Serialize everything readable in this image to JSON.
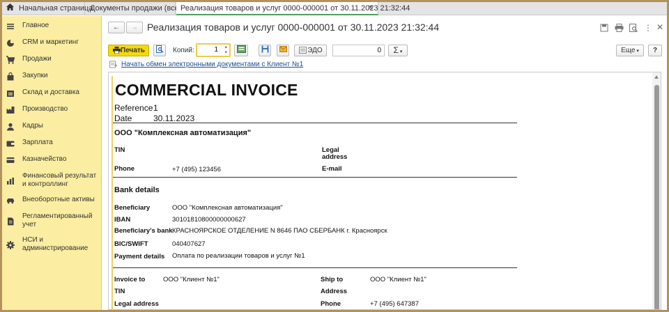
{
  "tabs": [
    {
      "label": "Начальная страница"
    },
    {
      "label": "Документы продажи (все)"
    },
    {
      "label": "Реализация товаров и услуг 0000-000001 от 30.11.2023 21:32:44"
    }
  ],
  "sidebar": {
    "items": [
      {
        "label": "Главное",
        "icon": "menu-icon"
      },
      {
        "label": "CRM и маркетинг",
        "icon": "pie-chart-icon"
      },
      {
        "label": "Продажи",
        "icon": "shopping-cart-icon"
      },
      {
        "label": "Закупки",
        "icon": "shopping-bag-icon"
      },
      {
        "label": "Склад и доставка",
        "icon": "warehouse-icon"
      },
      {
        "label": "Производство",
        "icon": "factory-icon"
      },
      {
        "label": "Кадры",
        "icon": "person-icon"
      },
      {
        "label": "Зарплата",
        "icon": "wallet-icon"
      },
      {
        "label": "Казначейство",
        "icon": "bank-card-icon"
      },
      {
        "label": "Финансовый результат и контроллинг",
        "icon": "bar-chart-icon"
      },
      {
        "label": "Внеоборотные активы",
        "icon": "car-icon"
      },
      {
        "label": "Регламентированный учет",
        "icon": "document-icon"
      },
      {
        "label": "НСИ и администрирование",
        "icon": "gear-icon"
      }
    ]
  },
  "header": {
    "title": "Реализация товаров и услуг 0000-000001 от 30.11.2023 21:32:44"
  },
  "toolbar": {
    "print_label": "Печать",
    "copies_label": "Копий:",
    "copies_value": "1",
    "edo_label": "ЭДО",
    "sum_value": "0",
    "sigma_label": "Σ",
    "more_label": "Еще",
    "help_label": "?"
  },
  "edo_link": "Начать обмен электронными документами с Клиент №1",
  "invoice": {
    "title": "COMMERCIAL INVOICE",
    "reference_label": "Reference",
    "reference_value": "1",
    "date_label": "Date",
    "date_value": "30.11.2023",
    "company_name": "ООО \"Комплексная автоматизация\"",
    "tin_label": "TIN",
    "legal_label_line1": "Legal",
    "legal_label_line2": "address",
    "phone_label": "Phone",
    "phone_value": "+7 (495) 123456",
    "email_label": "E-mail",
    "bank_heading": "Bank details",
    "beneficiary_label": "Beneficiary",
    "beneficiary_value": "ООО \"Комплексная автоматизация\"",
    "iban_label": "IBAN",
    "iban_value": "30101810800000000627",
    "beneficiary_bank_label": "Beneficiary's bank",
    "beneficiary_bank_value": "КРАСНОЯРСКОЕ ОТДЕЛЕНИЕ N 8646 ПАО СБЕРБАНК г. Красноярск",
    "bic_label": "BIC/SWIFT",
    "bic_value": "040407627",
    "payment_label": "Payment details",
    "payment_value": "Оплата по реализации товаров и услуг №1",
    "invoice_to_label": "Invoice to",
    "invoice_to_value": "ООО \"Клиент №1\"",
    "ship_to_label": "Ship to",
    "ship_to_value": "ООО \"Клиент №1\"",
    "tin2_label": "TIN",
    "address_label": "Address",
    "legal_address_label": "Legal address",
    "phone2_label": "Phone",
    "phone2_value": "+7 (495) 647387"
  },
  "colors": {
    "sidebar_bg": "#fbeea2",
    "print_button": "#f5d90a",
    "active_tab_underline": "#4f9e5d",
    "link": "#1a4f8e",
    "frame": "#b3925e"
  }
}
